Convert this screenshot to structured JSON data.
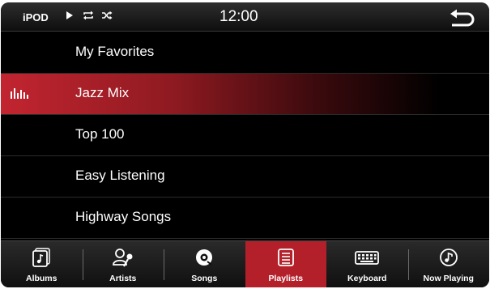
{
  "status_bar": {
    "source": "iPOD",
    "clock": "12:00",
    "icons": [
      "play-icon",
      "repeat-icon",
      "shuffle-icon",
      "back-arrow-icon"
    ]
  },
  "playlists": [
    {
      "label": "My Favorites",
      "active": false
    },
    {
      "label": "Jazz Mix",
      "active": true,
      "indicator": "equalizer-icon"
    },
    {
      "label": "Top 100",
      "active": false
    },
    {
      "label": "Easy Listening",
      "active": false
    },
    {
      "label": "Highway Songs",
      "active": false
    }
  ],
  "tabs": [
    {
      "label": "Albums",
      "icon": "album-icon",
      "active": false
    },
    {
      "label": "Artists",
      "icon": "artist-icon",
      "active": false
    },
    {
      "label": "Songs",
      "icon": "disc-icon",
      "active": false
    },
    {
      "label": "Playlists",
      "icon": "playlist-icon",
      "active": true
    },
    {
      "label": "Keyboard",
      "icon": "keyboard-icon",
      "active": false
    },
    {
      "label": "Now Playing",
      "icon": "music-note-icon",
      "active": false
    }
  ],
  "colors": {
    "accent": "#b3202a",
    "background": "#000000",
    "text": "#ffffff"
  }
}
